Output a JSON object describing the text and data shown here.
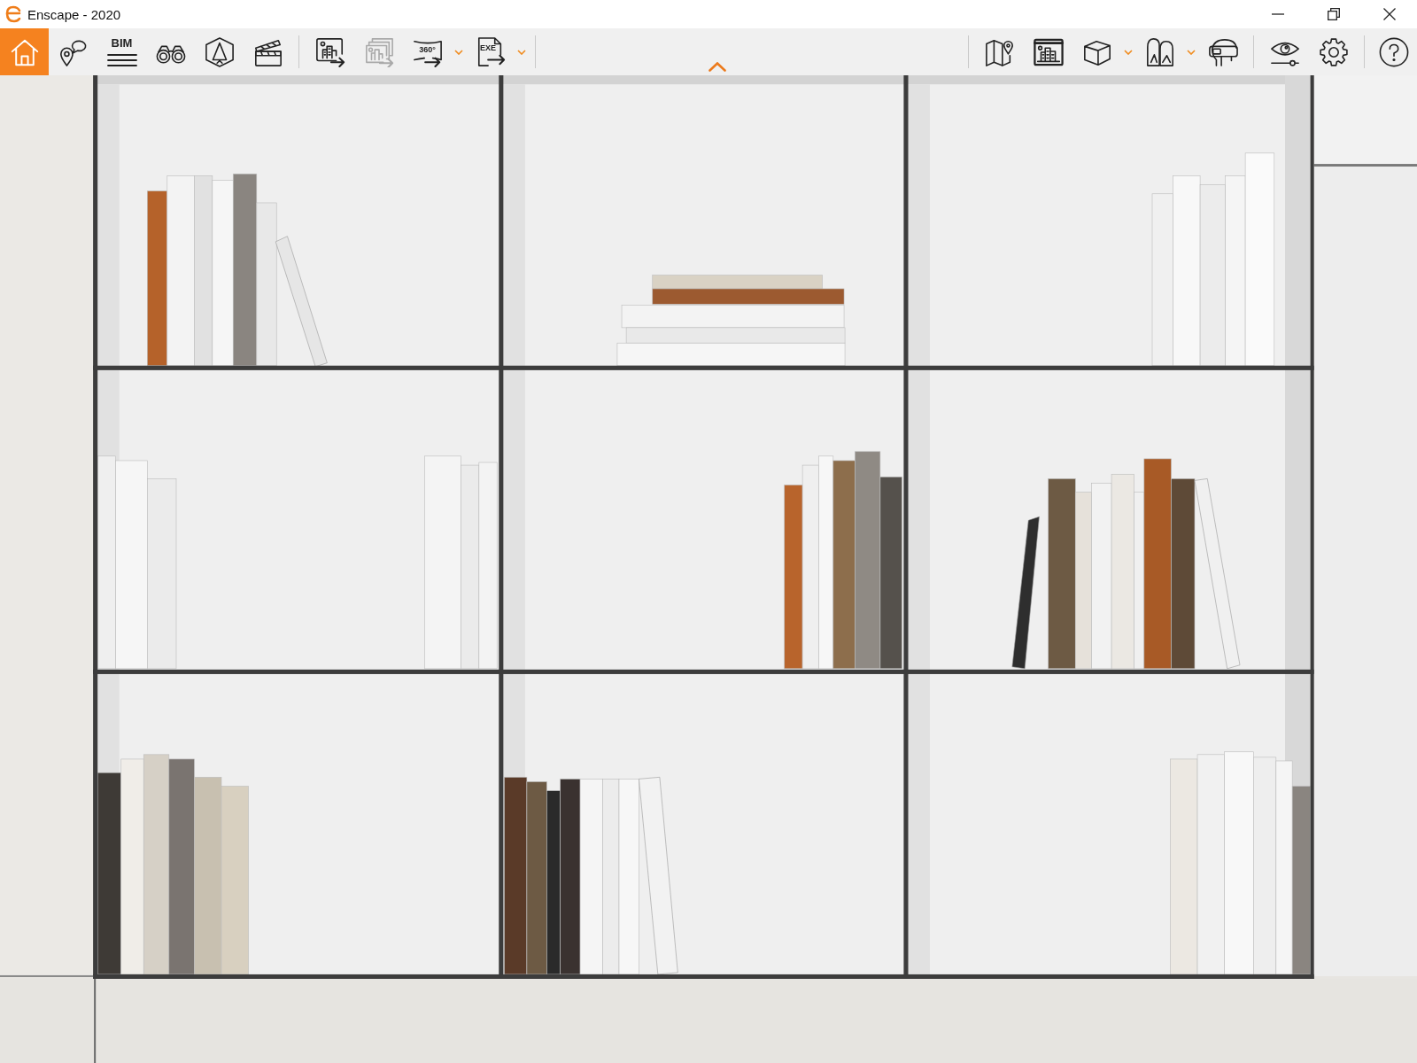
{
  "window": {
    "title": "Enscape - 2020",
    "controls": [
      {
        "kind": "minimize"
      },
      {
        "kind": "restore"
      },
      {
        "kind": "close"
      }
    ]
  },
  "toolbar": {
    "left": [
      {
        "items": [
          {
            "kind": "home",
            "disabled": false,
            "dropdown": false
          },
          {
            "kind": "views",
            "disabled": false,
            "dropdown": false
          },
          {
            "kind": "bim",
            "label": "BIM",
            "disabled": false,
            "dropdown": false
          },
          {
            "kind": "walk",
            "disabled": false,
            "dropdown": false
          },
          {
            "kind": "perspective",
            "disabled": false,
            "dropdown": false
          },
          {
            "kind": "video",
            "disabled": false,
            "dropdown": false
          }
        ]
      },
      {
        "items": [
          {
            "kind": "screenshot",
            "disabled": false,
            "dropdown": false
          },
          {
            "kind": "batch",
            "disabled": true,
            "dropdown": false
          },
          {
            "kind": "panorama",
            "label": "360°",
            "disabled": false,
            "dropdown": true
          },
          {
            "kind": "exe",
            "label": "EXE",
            "disabled": false,
            "dropdown": true
          }
        ]
      }
    ],
    "right": [
      {
        "items": [
          {
            "kind": "map",
            "disabled": false,
            "dropdown": false
          },
          {
            "kind": "assets",
            "disabled": false,
            "dropdown": false
          },
          {
            "kind": "cube",
            "disabled": false,
            "dropdown": true
          },
          {
            "kind": "arches",
            "disabled": false,
            "dropdown": true
          },
          {
            "kind": "headset",
            "disabled": false,
            "dropdown": false
          }
        ]
      },
      {
        "items": [
          {
            "kind": "eye",
            "disabled": false,
            "dropdown": false
          },
          {
            "kind": "settings",
            "disabled": false,
            "dropdown": false
          }
        ]
      },
      {
        "items": [
          {
            "kind": "help",
            "disabled": false,
            "dropdown": false
          }
        ]
      }
    ]
  }
}
